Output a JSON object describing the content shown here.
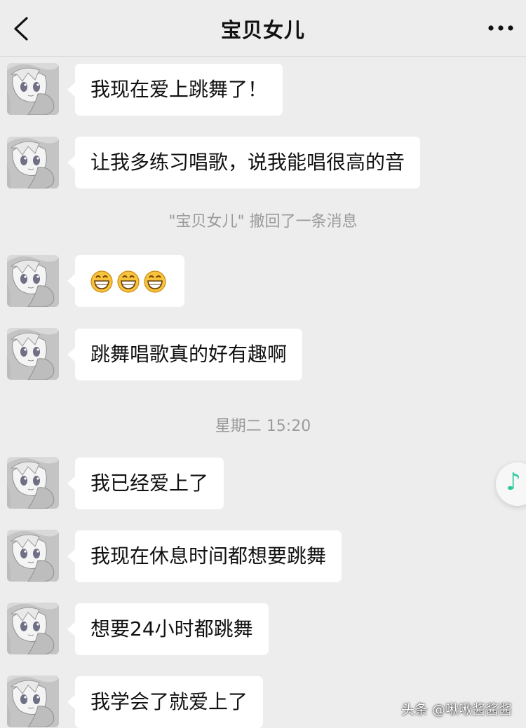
{
  "header": {
    "title": "宝贝女儿",
    "back_icon": "chevron-left-icon",
    "more_icon": "more-dots-icon"
  },
  "messages": [
    {
      "type": "text",
      "text": "我现在爱上跳舞了！"
    },
    {
      "type": "text",
      "text": "让我多练习唱歌，说我能唱很高的音"
    },
    {
      "type": "system",
      "text": "\"宝贝女儿\" 撤回了一条消息"
    },
    {
      "type": "emoji",
      "emojis": [
        "grinning-face-icon",
        "grinning-face-icon",
        "grinning-face-icon"
      ]
    },
    {
      "type": "text",
      "text": "跳舞唱歌真的好有趣啊"
    },
    {
      "type": "system",
      "text": "星期二 15:20"
    },
    {
      "type": "text",
      "text": "我已经爱上了"
    },
    {
      "type": "text",
      "text": "我现在休息时间都想要跳舞"
    },
    {
      "type": "text",
      "text": "想要24小时都跳舞"
    },
    {
      "type": "text",
      "text": "我学会了就爱上了"
    }
  ],
  "floating": {
    "icon": "music-note-icon",
    "glyph": "♪",
    "color": "#2dc9a0"
  },
  "watermark": "头条 @啾啾酱酱酱",
  "colors": {
    "background": "#ededed",
    "bubble": "#ffffff",
    "system_text": "#9a9a9a"
  }
}
